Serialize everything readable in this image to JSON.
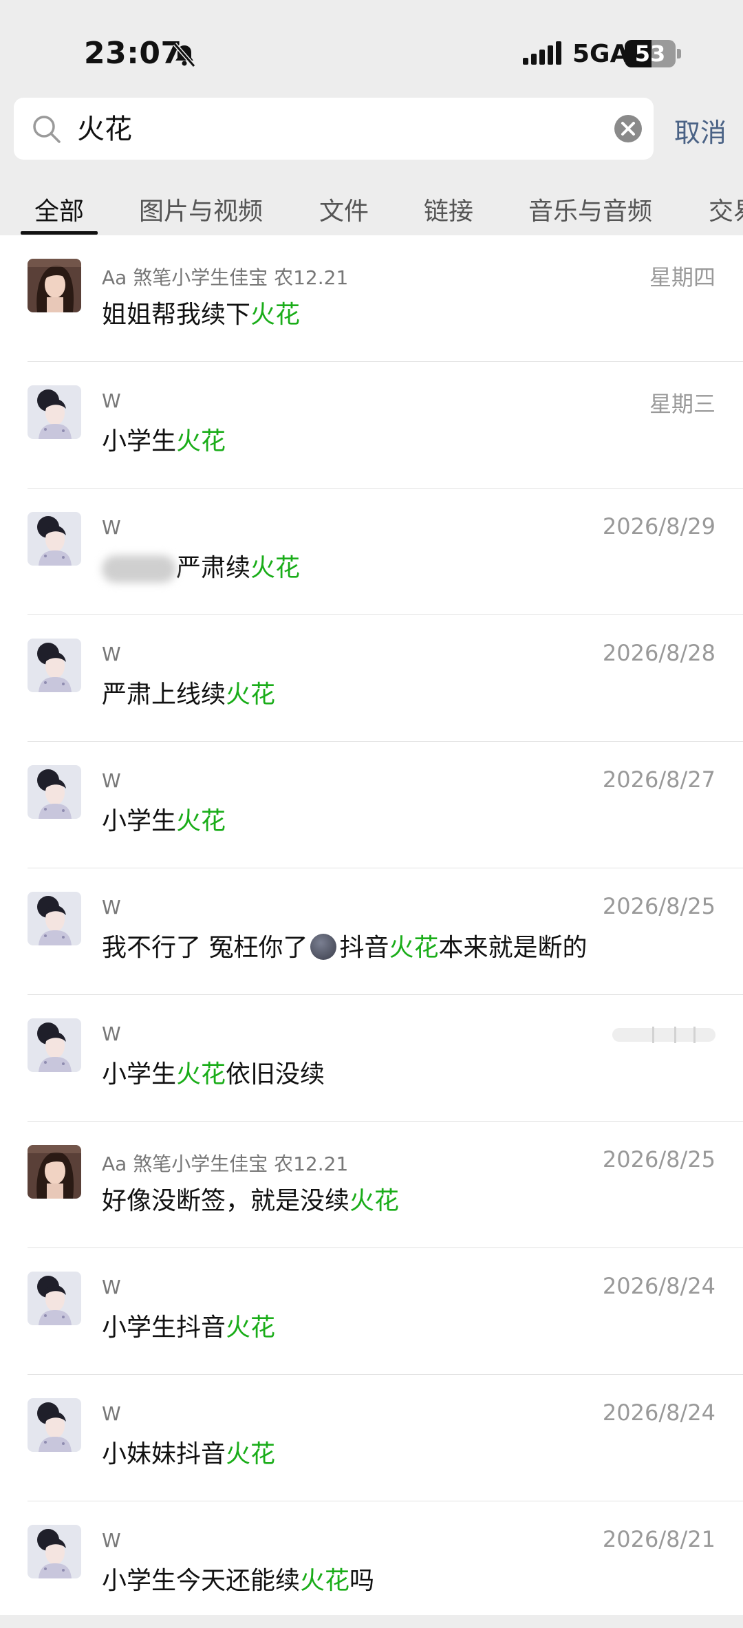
{
  "status_bar": {
    "time": "23:07",
    "network": "5GA",
    "battery": "53",
    "battery_level": 0.53
  },
  "search": {
    "query": "火花",
    "cancel_label": "取消"
  },
  "tabs": [
    {
      "label": "全部",
      "active": true
    },
    {
      "label": "图片与视频"
    },
    {
      "label": "文件"
    },
    {
      "label": "链接"
    },
    {
      "label": "音乐与音频"
    },
    {
      "label": "交易"
    }
  ],
  "results": [
    {
      "sender": "Aa 煞笔小学生佳宝 农12.21",
      "date": "星期四",
      "pre": "姐姐帮我续下",
      "hl": "火花",
      "post": "",
      "avatar": "a"
    },
    {
      "sender": "W",
      "date": "星期三",
      "pre": "小学生",
      "hl": "火花",
      "post": "",
      "avatar": "w"
    },
    {
      "sender": "W",
      "date": "2026/8/29",
      "pre": "严肃续",
      "hl": "火花",
      "post": "",
      "avatar": "w",
      "blurred_prefix": true
    },
    {
      "sender": "W",
      "date": "2026/8/28",
      "pre": "严肃上线续",
      "hl": "火花",
      "post": "",
      "avatar": "w"
    },
    {
      "sender": "W",
      "date": "2026/8/27",
      "pre": "小学生",
      "hl": "火花",
      "post": "",
      "avatar": "w"
    },
    {
      "sender": "W",
      "date": "2026/8/25",
      "pre": "我不行了 冤枉你了",
      "hl": "火花",
      "post": "本来就是断的",
      "avatar": "w",
      "emoji_then": "抖音"
    },
    {
      "sender": "W",
      "date": "",
      "pre": "小学生",
      "hl": "火花",
      "post": "依旧没续",
      "avatar": "w",
      "date_blurred": true
    },
    {
      "sender": "Aa 煞笔小学生佳宝 农12.21",
      "date": "2026/8/25",
      "pre": "好像没断签，就是没续",
      "hl": "火花",
      "post": "",
      "avatar": "a"
    },
    {
      "sender": "W",
      "date": "2026/8/24",
      "pre": "小学生抖音",
      "hl": "火花",
      "post": "",
      "avatar": "w"
    },
    {
      "sender": "W",
      "date": "2026/8/24",
      "pre": "小妹妹抖音",
      "hl": "火花",
      "post": "",
      "avatar": "w"
    },
    {
      "sender": "W",
      "date": "2026/8/21",
      "pre": "小学生今天还能续",
      "hl": "火花",
      "post": "吗",
      "avatar": "w"
    }
  ]
}
